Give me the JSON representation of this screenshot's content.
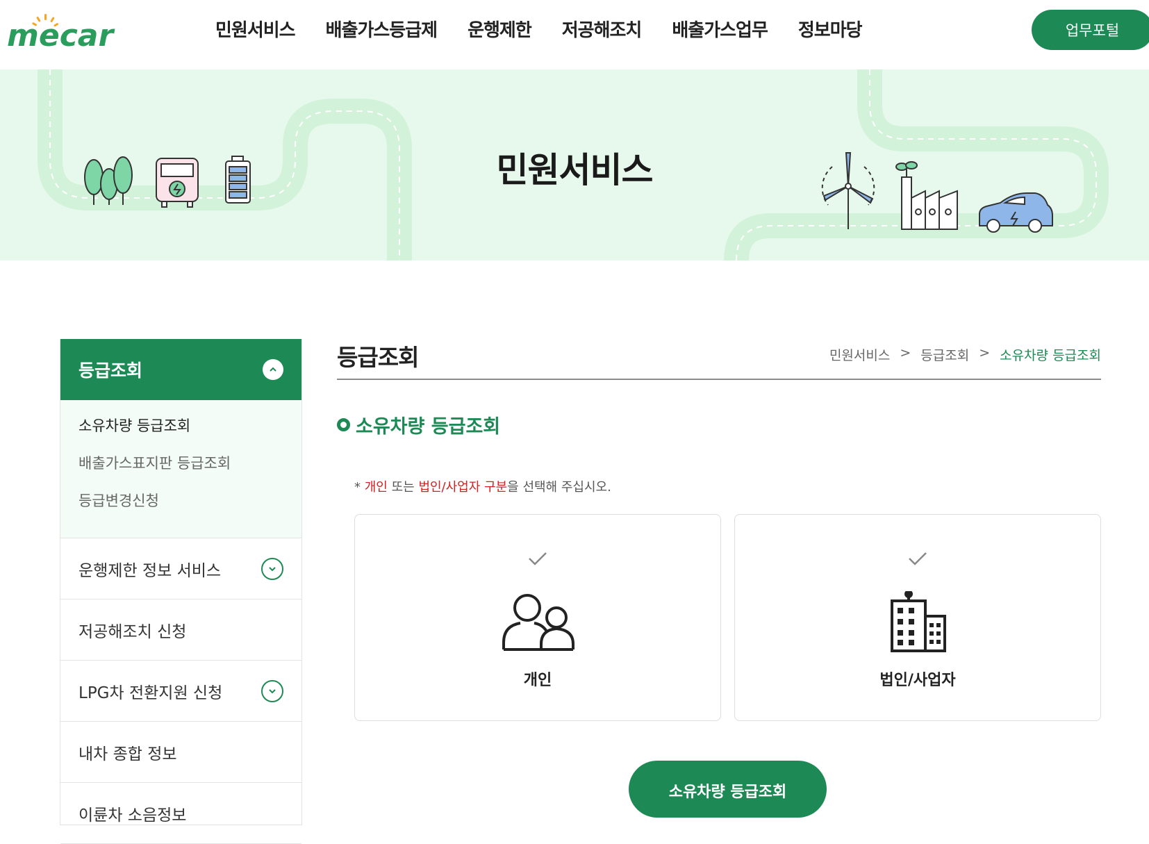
{
  "header": {
    "logo_text": "mecar",
    "nav": [
      "민원서비스",
      "배출가스등급제",
      "운행제한",
      "저공해조치",
      "배출가스업무",
      "정보마당"
    ],
    "portal_button": "업무포털"
  },
  "banner": {
    "title": "민원서비스"
  },
  "sidebar": {
    "head_label": "등급조회",
    "sub_items": [
      "소유차량 등급조회",
      "배출가스표지판 등급조회",
      "등급변경신청"
    ],
    "items": [
      "운행제한 정보 서비스",
      "저공해조치 신청",
      "LPG차 전환지원 신청",
      "내차 종합 정보",
      "이륜차 소음정보"
    ]
  },
  "content": {
    "page_title": "등급조회",
    "breadcrumb": [
      "민원서비스",
      ">",
      "등급조회",
      ">",
      "소유차량 등급조회"
    ],
    "section_title": "소유차량 등급조회",
    "notice": {
      "prefix": "* ",
      "red1": "개인",
      "mid": " 또는 ",
      "red2": "법인/사업자 구분",
      "suffix": "을 선택해 주십시오."
    },
    "cards": [
      {
        "label": "개인",
        "icon": "people-icon"
      },
      {
        "label": "법인/사업자",
        "icon": "building-icon"
      }
    ],
    "submit_button": "소유차량 등급조회"
  },
  "colors": {
    "brand_green": "#1d8a55",
    "banner_bg": "#e6f9ec",
    "notice_red": "#d32020"
  }
}
